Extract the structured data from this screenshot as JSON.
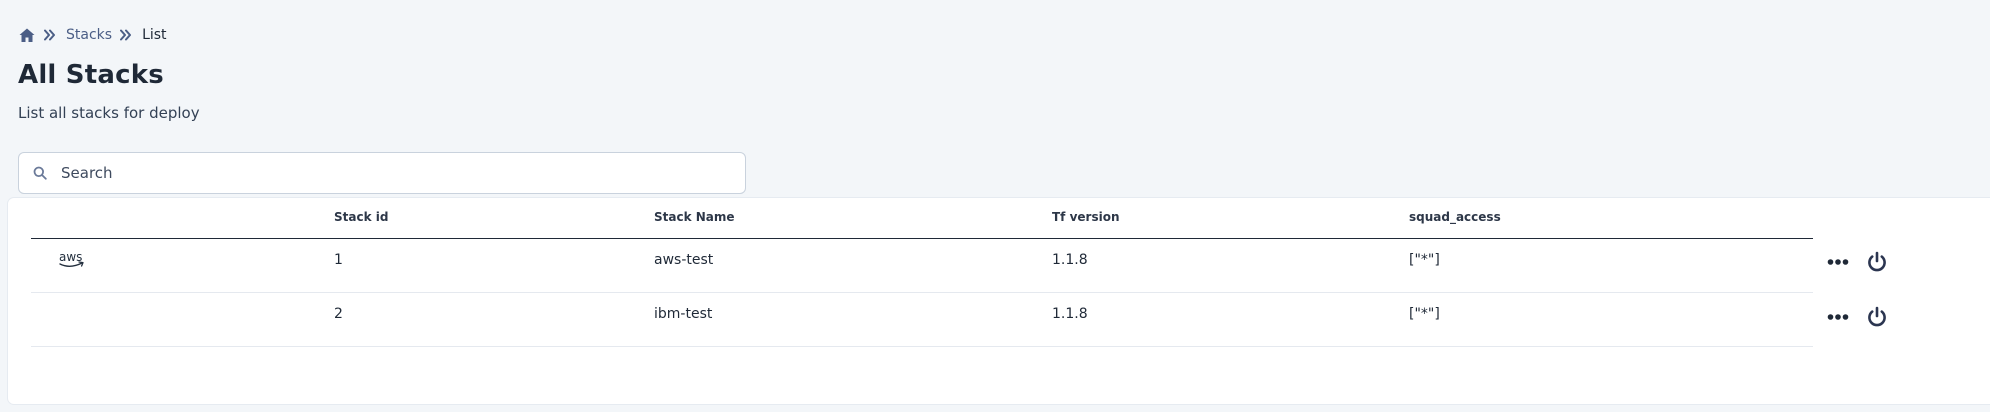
{
  "breadcrumb": {
    "home_icon": "home-icon",
    "separator_icon": "double-chevron-right-icon",
    "items": [
      "Stacks",
      "List"
    ]
  },
  "page": {
    "title": "All Stacks",
    "subtitle": "List all stacks for deploy"
  },
  "search": {
    "placeholder": "Search",
    "value": ""
  },
  "table": {
    "columns": [
      "",
      "Stack id",
      "Stack Name",
      "Tf version",
      "squad_access",
      ""
    ],
    "rows": [
      {
        "logo": "aws",
        "stack_id": "1",
        "stack_name": "aws-test",
        "tf_version": "1.1.8",
        "squad_access": "[\"*\"]"
      },
      {
        "logo": "",
        "stack_id": "2",
        "stack_name": "ibm-test",
        "tf_version": "1.1.8",
        "squad_access": "[\"*\"]"
      }
    ]
  },
  "icons": {
    "more": "more-horizontal-icon",
    "power": "power-icon",
    "search": "search-icon"
  },
  "colors": {
    "background": "#f3f6f9",
    "link": "#4b5e86",
    "text": "#1f2937",
    "icon": "#2b3550"
  }
}
